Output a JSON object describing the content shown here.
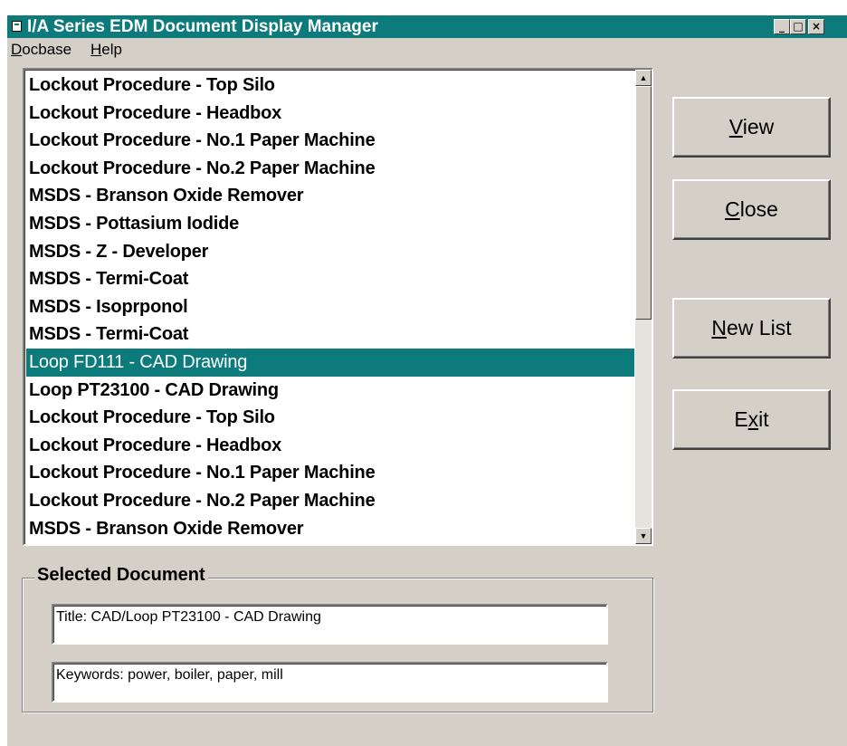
{
  "window": {
    "title": "I/A Series EDM Document Display Manager",
    "minimize_glyph": "_",
    "maximize_glyph": "□",
    "close_glyph": "×"
  },
  "menu": {
    "docbase": {
      "label_u": "D",
      "label_rest": "ocbase"
    },
    "help": {
      "label_u": "H",
      "label_rest": "elp"
    }
  },
  "documents": [
    "Lockout Procedure - Top Silo",
    "Lockout Procedure - Headbox",
    "Lockout Procedure - No.1 Paper Machine",
    "Lockout Procedure - No.2 Paper Machine",
    "MSDS - Branson Oxide Remover",
    "MSDS - Pottasium Iodide",
    "MSDS - Z - Developer",
    "MSDS - Termi-Coat",
    "MSDS - Isoprponol",
    "MSDS - Termi-Coat",
    "Loop FD111 - CAD Drawing",
    "Loop PT23100 - CAD Drawing",
    "Lockout Procedure - Top Silo",
    "Lockout Procedure - Headbox",
    "Lockout Procedure - No.1 Paper Machine",
    "Lockout Procedure - No.2 Paper Machine",
    "MSDS - Branson Oxide Remover"
  ],
  "selected_index": 10,
  "buttons": {
    "view": {
      "u": "V",
      "rest": "iew"
    },
    "close": {
      "u": "C",
      "rest": "lose"
    },
    "new_list": {
      "u": "N",
      "rest": "ew List"
    },
    "exit": {
      "pre": "E",
      "u": "x",
      "rest": "it"
    }
  },
  "selected_document": {
    "legend": "Selected Document",
    "title": "Title:  CAD/Loop PT23100 - CAD Drawing",
    "keywords": "Keywords:  power, boiler, paper, mill"
  },
  "colors": {
    "titlebar": "#0d7b7b",
    "selection": "#0d7b7b",
    "face": "#d4d0c8"
  }
}
